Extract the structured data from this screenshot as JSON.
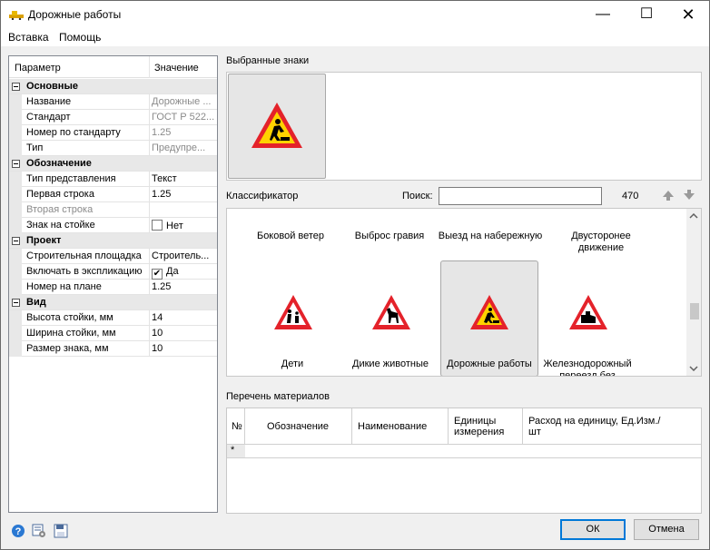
{
  "window": {
    "title": "Дорожные работы"
  },
  "menu": [
    "Вставка",
    "Помощь"
  ],
  "props": {
    "col_param": "Параметр",
    "col_value": "Значение",
    "rows": [
      {
        "type": "cat",
        "name": "Основные"
      },
      {
        "name": "Название",
        "value": "Дорожные ...",
        "gray": true
      },
      {
        "name": "Стандарт",
        "value": "ГОСТ Р 522...",
        "gray": true
      },
      {
        "name": "Номер по стандарту",
        "value": "1.25",
        "gray": true
      },
      {
        "name": "Тип",
        "value": "Предупре...",
        "gray": true
      },
      {
        "type": "cat",
        "name": "Обозначение"
      },
      {
        "name": "Тип представления",
        "value": "Текст"
      },
      {
        "name": "Первая строка",
        "value": "1.25"
      },
      {
        "name": "Вторая строка",
        "value": "",
        "gray_name": true
      },
      {
        "name": "Знак на стойке",
        "value": "Нет",
        "check": false
      },
      {
        "type": "cat",
        "name": "Проект"
      },
      {
        "name": "Строительная площадка",
        "value": "Строитель..."
      },
      {
        "name": "Включать в экспликацию",
        "value": "Да",
        "check": true
      },
      {
        "name": "Номер на плане",
        "value": "1.25"
      },
      {
        "type": "cat",
        "name": "Вид"
      },
      {
        "name": "Высота стойки, мм",
        "value": "14"
      },
      {
        "name": "Ширина стойки, мм",
        "value": "10"
      },
      {
        "name": "Размер знака, мм",
        "value": "10"
      }
    ]
  },
  "selected_label": "Выбранные знаки",
  "classifier": {
    "label": "Классификатор",
    "search_label": "Поиск:",
    "search_value": "",
    "count": "470",
    "top_labels": [
      "Боковой ветер",
      "Выброс гравия",
      "Выезд на набережную",
      "Двусторонее движение"
    ],
    "items": [
      "Дети",
      "Дикие животные",
      "Дорожные работы",
      "Железнодорожный переезд без"
    ]
  },
  "materials": {
    "label": "Перечень материалов",
    "columns": [
      "№",
      "Обозначение",
      "Наименование",
      "Единицы измерения",
      "Расход на единицу, Ед.Изм./шт"
    ],
    "new_row_marker": "*"
  },
  "buttons": {
    "ok": "ОК",
    "cancel": "Отмена"
  },
  "colors": {
    "accent": "#0078d7",
    "sign_red": "#e4222a",
    "sign_yellow": "#ffd200"
  }
}
